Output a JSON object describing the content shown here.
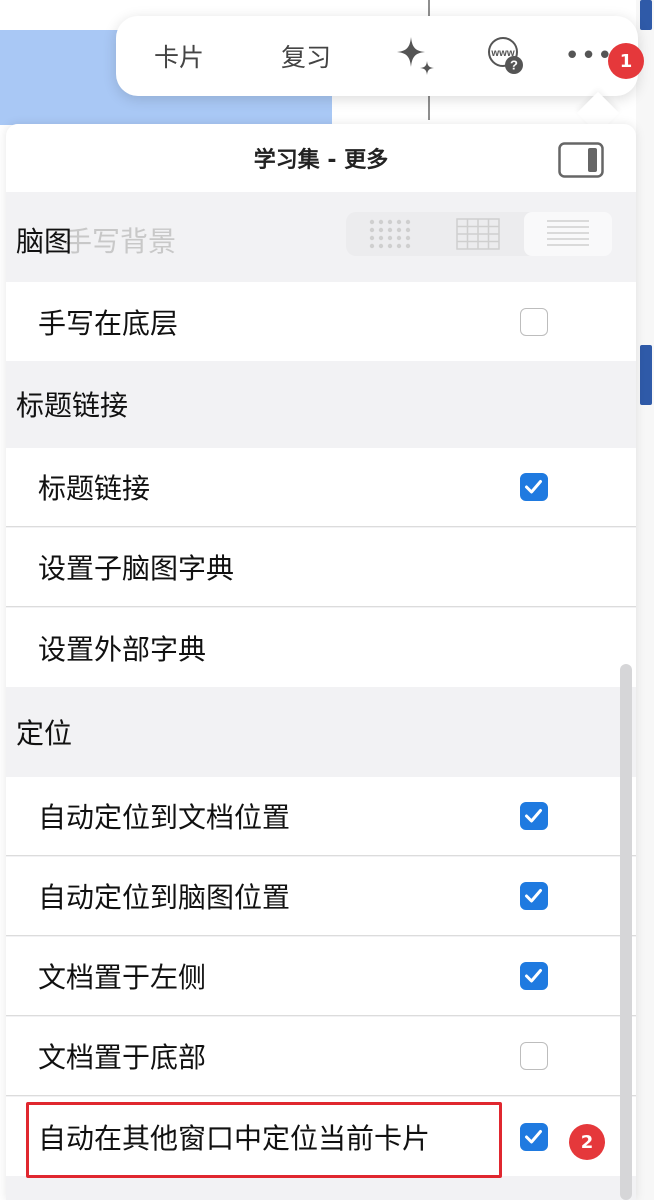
{
  "toolbar": {
    "cards_label": "卡片",
    "review_label": "复习",
    "sparkle_icon": "sparkle-icon",
    "web_icon": "www-help-icon",
    "more_label": "•••",
    "badge_1": "1"
  },
  "panel": {
    "title": "学习集 - 更多",
    "ghost_text": "手写背景"
  },
  "sections": {
    "mindmap": "脑图",
    "title_link": "标题链接",
    "locate": "定位"
  },
  "rows": {
    "handwriting_bottom": "手写在底层",
    "title_link": "标题链接",
    "sub_dict": "设置子脑图字典",
    "ext_dict": "设置外部字典",
    "auto_locate_doc": "自动定位到文档位置",
    "auto_locate_map": "自动定位到脑图位置",
    "doc_left": "文档置于左侧",
    "doc_bottom": "文档置于底部",
    "locate_other_windows": "自动在其他窗口中定位当前卡片"
  },
  "checks": {
    "handwriting_bottom": false,
    "title_link": true,
    "auto_locate_doc": true,
    "auto_locate_map": true,
    "doc_left": true,
    "doc_bottom": false,
    "locate_other_windows": true
  },
  "badge_2": "2",
  "colors": {
    "accent": "#1f7ae0",
    "badge": "#e5383b",
    "highlight": "#e0272f"
  }
}
